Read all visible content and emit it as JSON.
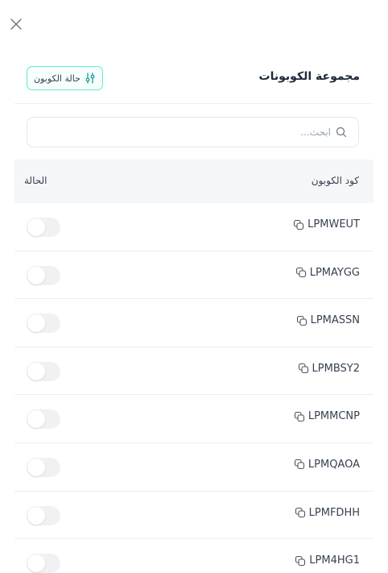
{
  "header": {
    "title": "مجموعة الكوبونات",
    "filter_label": "حالة الكوبون",
    "filter_icon": "sliders-icon",
    "close_icon": "close-icon"
  },
  "search": {
    "placeholder": "ابحث...",
    "value": "",
    "icon": "search-icon"
  },
  "table": {
    "columns": [
      "كود الكوبون",
      "الحالة"
    ],
    "rows": [
      {
        "code": "LPMWEUT",
        "active": false
      },
      {
        "code": "LPMAYGG",
        "active": false
      },
      {
        "code": "LPMASSN",
        "active": false
      },
      {
        "code": "LPMBSY2",
        "active": false
      },
      {
        "code": "LPMMCNP",
        "active": false
      },
      {
        "code": "LPMQAOA",
        "active": false
      },
      {
        "code": "LPMFDHH",
        "active": false
      },
      {
        "code": "LPM4HG1",
        "active": false
      }
    ]
  },
  "colors": {
    "accent": "#5eead4",
    "header_bg": "#f5f6f8",
    "toggle_off": "#f0f1f3"
  }
}
